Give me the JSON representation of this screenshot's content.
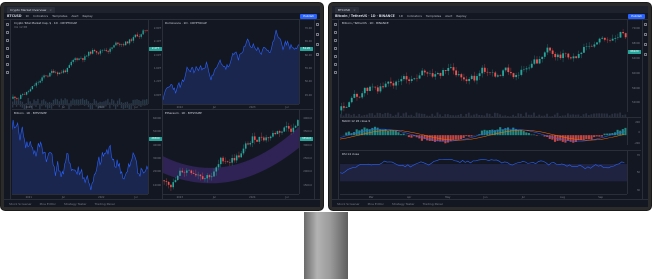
{
  "left_monitor": {
    "tab_label": "Crypto Market Overview",
    "toolbar": {
      "symbol": "BTCUSD",
      "items": [
        "1h",
        "Indicators",
        "Templates",
        "Alert",
        "Replay"
      ],
      "publish": "Publish"
    },
    "panes": [
      {
        "id": "tl",
        "legend": "Crypto Total Market Cap, $ · 1D · CRYPTOCAP",
        "ind": "Vol 12.5B",
        "price_ticks": [
          "2.80T",
          "2.40T",
          "2.00T",
          "1.60T",
          "1.20T",
          "0.80T"
        ],
        "time_ticks": [
          "2023",
          "Jul",
          "2024",
          "Jul"
        ],
        "price_label": "2.47T"
      },
      {
        "id": "tr",
        "legend": "Dominance · 1D · CRYPTOCAP",
        "ind": "",
        "price_ticks": [
          "70.00",
          "65.00",
          "60.00",
          "55.00",
          "50.00",
          "45.00"
        ],
        "time_ticks": [
          "2022",
          "Jul",
          "2023",
          "Jul"
        ],
        "price_label": "54.20"
      },
      {
        "id": "bl",
        "legend": "Bitcoin · 1D · BITSTAMP",
        "ind": "",
        "price_ticks": [
          "60000",
          "50000",
          "40000",
          "30000",
          "20000",
          "10000"
        ],
        "time_ticks": [
          "2021",
          "Jul",
          "2022",
          "Jul"
        ],
        "price_label": "26500"
      },
      {
        "id": "br",
        "legend": "Ethereum · 1D · BITSTAMP",
        "ind": "",
        "price_ticks": [
          "4000.0",
          "3500.0",
          "3000.0",
          "2500.0",
          "2000.0",
          "1500.0"
        ],
        "time_ticks": [
          "2023",
          "Jul",
          "2024",
          "Jul"
        ],
        "price_label": "3350.0"
      }
    ],
    "bottom_items": [
      "Stock Screener",
      "Pine Editor",
      "Strategy Tester",
      "Trading Panel"
    ]
  },
  "right_monitor": {
    "tab_label": "BTCUSD",
    "toolbar": {
      "symbol": "Bitcoin / TetherUS · 1D · BINANCE",
      "items": [
        "1D",
        "Indicators",
        "Templates",
        "Alert",
        "Replay"
      ],
      "publish": "Publish"
    },
    "main": {
      "legend": "Bitcoin / TetherUS · 1D · BINANCE",
      "price_ticks": [
        "72000",
        "68000",
        "64000",
        "60000",
        "56000",
        "52000"
      ],
      "price_label": "66120"
    },
    "macd": {
      "legend": "MACD 12 26 close 9"
    },
    "rsi": {
      "legend": "RSI 14 close"
    },
    "time_ticks": [
      "Mar",
      "Apr",
      "May",
      "Jun",
      "Jul",
      "Aug",
      "Sep"
    ],
    "bottom_items": [
      "Stock Screener",
      "Pine Editor",
      "Strategy Tester",
      "Trading Panel"
    ]
  },
  "colors": {
    "up": "#26a69a",
    "down": "#ef5350",
    "line": "#2962ff",
    "area": "#1e2a5a",
    "macd_signal": "#ff6d00",
    "price_label": "#26a69a"
  }
}
